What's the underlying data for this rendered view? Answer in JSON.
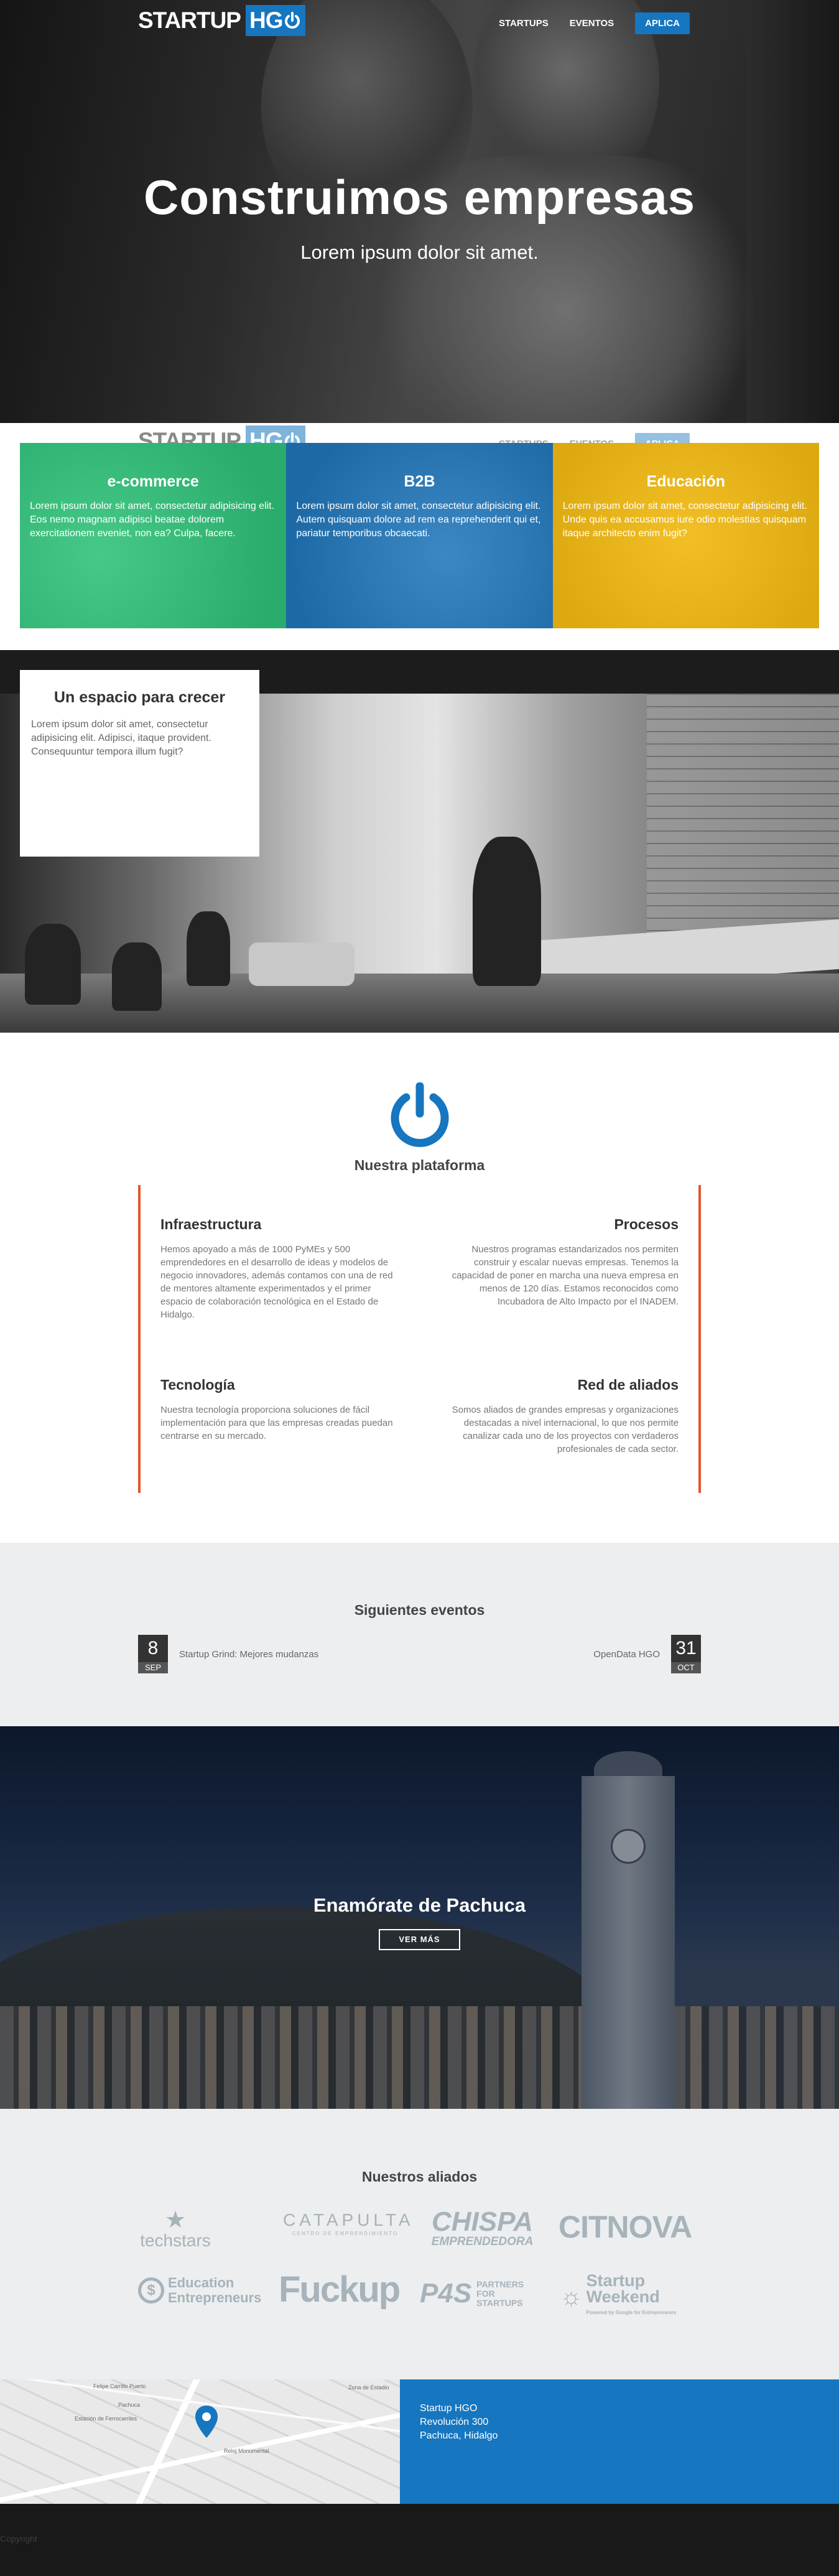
{
  "nav": {
    "logo_word1": "STARTUP",
    "logo_word2": "HG",
    "links": [
      "STARTUPS",
      "EVENTOS"
    ],
    "apply": "APLICA"
  },
  "hero": {
    "title": "Construimos empresas",
    "subtitle": "Lorem ipsum dolor sit amet."
  },
  "categories": [
    {
      "title": "e-commerce",
      "text": "Lorem ipsum dolor sit amet, consectetur adipisicing elit. Eos nemo magnam adipisci beatae dolorem exercitationem eveniet, non ea? Culpa, facere."
    },
    {
      "title": "B2B",
      "text": "Lorem ipsum dolor sit amet, consectetur adipisicing elit. Autem quisquam dolore ad rem ea reprehenderit qui et, pariatur temporibus obcaecati."
    },
    {
      "title": "Educación",
      "text": "Lorem ipsum dolor sit amet, consectetur adipisicing elit. Unde quis ea accusamus iure odio molestias quisquam itaque architecto enim fugit?"
    }
  ],
  "space": {
    "title": "Un espacio para crecer",
    "text": "Lorem ipsum dolor sit amet, consectetur adipisicing elit. Adipisci, itaque provident. Consequuntur tempora illum fugit?"
  },
  "platform": {
    "title": "Nuestra plataforma",
    "items": [
      {
        "title": "Infraestructura",
        "text": "Hemos apoyado a más de 1000 PyMEs y 500 emprendedores en el desarrollo de ideas y modelos de negocio innovadores, además contamos con una de red de mentores altamente experimentados y el primer espacio de colaboración tecnológica en el Estado de Hidalgo."
      },
      {
        "title": "Procesos",
        "text": "Nuestros programas estandarizados nos permiten construir y escalar nuevas empresas. Tenemos la capacidad de poner en marcha una nueva empresa en menos de 120 días. Estamos reconocidos como Incubadora de Alto Impacto por el INADEM."
      },
      {
        "title": "Tecnología",
        "text": "Nuestra tecnología proporciona soluciones de fácil implementación para que las empresas creadas puedan centrarse en su mercado."
      },
      {
        "title": "Red de aliados",
        "text": "Somos aliados de grandes empresas y organizaciones destacadas a nivel internacional, lo que nos permite canalizar cada uno de los proyectos con verdaderos profesionales de cada sector."
      }
    ]
  },
  "events": {
    "title": "Siguientes eventos",
    "items": [
      {
        "day": "8",
        "month": "SEP",
        "name": "Startup Grind: Mejores mudanzas"
      },
      {
        "day": "31",
        "month": "OCT",
        "name": "OpenData HGO"
      }
    ]
  },
  "pachuca": {
    "title": "Enamórate de Pachuca",
    "button": "VER MÁS"
  },
  "partners": {
    "title": "Nuestros aliados",
    "techstars": "techstars",
    "catapulta_main": "CATAPULTA",
    "catapulta_sub": "CENTRO DE EMPRENDIMIENTO",
    "chispa_main": "CHISPA",
    "chispa_sub": "EMPRENDEDORA",
    "citnova": "CITNOVA",
    "ee_line1": "Education",
    "ee_line2": "Entrepreneurs",
    "fuckup": "Fuckup",
    "p4s_main": "P4S",
    "p4s_sub1": "PARTNERS",
    "p4s_sub2": "FOR",
    "p4s_sub3": "STARTUPS",
    "sw_line1": "Startup",
    "sw_line2": "Weekend",
    "sw_sub": "Powered by Google for Entrepreneurs"
  },
  "map": {
    "labels": [
      "Estación de Ferrocarriles",
      "Pachuca",
      "Reloj Monumental",
      "Felipe Carrillo Puerto",
      "Zona de Estadio"
    ]
  },
  "contact": {
    "line1": "Startup HGO",
    "line2": "Revolución 300",
    "line3": "Pachuca, Hidalgo"
  },
  "footer": {
    "text": "Copyright"
  },
  "colors": {
    "brand_blue": "#1676c0",
    "ecommerce_green": "#26c676",
    "education_yellow": "#f5b905",
    "accent_orange": "#e0572b"
  }
}
